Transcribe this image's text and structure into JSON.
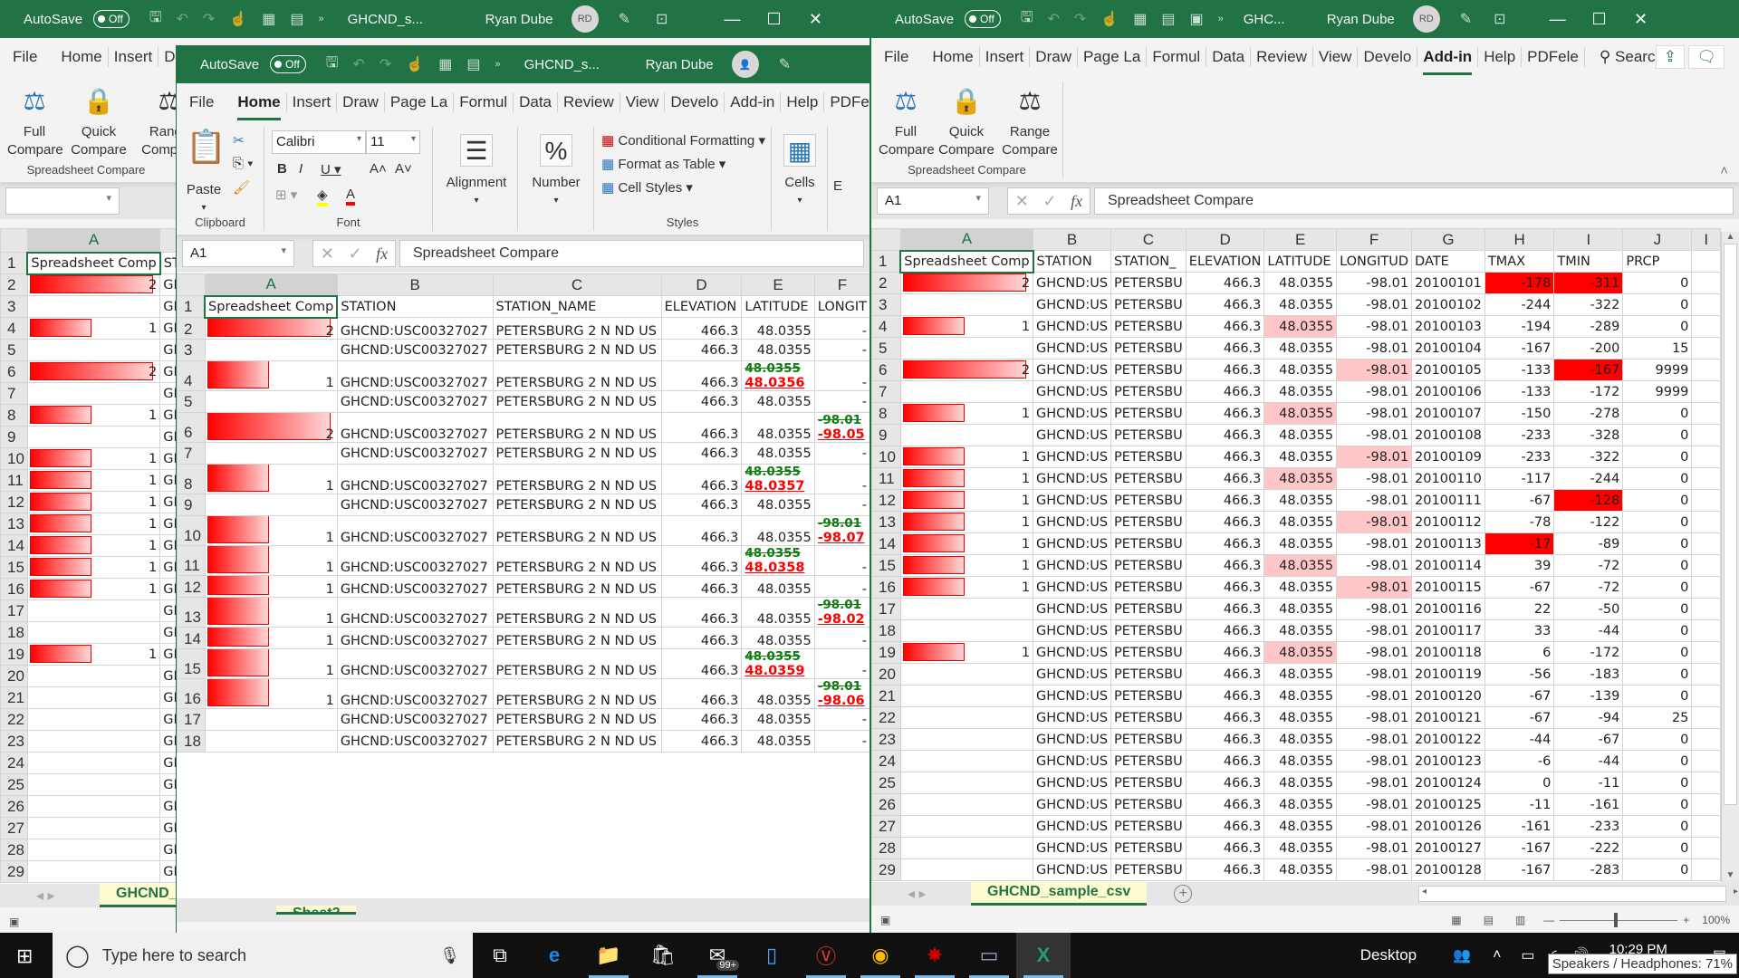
{
  "common": {
    "autosave_label": "AutoSave",
    "autosave_state": "Off",
    "user_name": "Ryan Dube",
    "user_initials": "RD",
    "addin_buttons": [
      {
        "line1": "Full",
        "line2": "Compare"
      },
      {
        "line1": "Quick",
        "line2": "Compare"
      },
      {
        "line1": "Range",
        "line2": "Compare"
      }
    ],
    "addin_group_label": "Spreadsheet Compare"
  },
  "left_window": {
    "title": "GHCND_s...",
    "tabs": [
      "File",
      "Home",
      "Insert",
      "D"
    ],
    "sheet_tab": "GHCND_s",
    "col_header": "A",
    "a1_value": "Spreadsheet Comp",
    "b1_partial": "ST",
    "rows": [
      {
        "r": "1"
      },
      {
        "r": "2",
        "v": "2",
        "w": 1.0
      },
      {
        "r": "3"
      },
      {
        "r": "4",
        "v": "1",
        "w": 0.5
      },
      {
        "r": "5"
      },
      {
        "r": "6",
        "v": "2",
        "w": 1.0
      },
      {
        "r": "7"
      },
      {
        "r": "8",
        "v": "1",
        "w": 0.5
      },
      {
        "r": "9"
      },
      {
        "r": "10",
        "v": "1",
        "w": 0.5
      },
      {
        "r": "11",
        "v": "1",
        "w": 0.5
      },
      {
        "r": "12",
        "v": "1",
        "w": 0.5
      },
      {
        "r": "13",
        "v": "1",
        "w": 0.5
      },
      {
        "r": "14",
        "v": "1",
        "w": 0.5
      },
      {
        "r": "15",
        "v": "1",
        "w": 0.5
      },
      {
        "r": "16",
        "v": "1",
        "w": 0.5
      },
      {
        "r": "17"
      },
      {
        "r": "18"
      },
      {
        "r": "19",
        "v": "1",
        "w": 0.5
      },
      {
        "r": "20"
      },
      {
        "r": "21"
      },
      {
        "r": "22"
      },
      {
        "r": "23"
      },
      {
        "r": "24"
      },
      {
        "r": "25"
      },
      {
        "r": "26"
      },
      {
        "r": "27"
      },
      {
        "r": "28"
      },
      {
        "r": "29"
      }
    ],
    "b_col_partial": "GI"
  },
  "middle_window": {
    "title": "GHCND_s...",
    "tabs": [
      "File",
      "Home",
      "Insert",
      "Draw",
      "Page La",
      "Formul",
      "Data",
      "Review",
      "View",
      "Develo",
      "Add-in",
      "Help",
      "PDFele"
    ],
    "active_tab": "Home",
    "ribbon": {
      "paste_label": "Paste",
      "clipboard_label": "Clipboard",
      "font_name": "Calibri",
      "font_size": "11",
      "font_label": "Font",
      "alignment_label": "Alignment",
      "number_label": "Number",
      "conditional_formatting": "Conditional Formatting",
      "format_as_table": "Format as Table",
      "cell_styles": "Cell Styles",
      "styles_label": "Styles",
      "cells_label": "Cells",
      "editing_partial": "E"
    },
    "name_box": "A1",
    "formula": "Spreadsheet Compare",
    "columns": [
      "A",
      "B",
      "C",
      "D",
      "E",
      "F"
    ],
    "headers": [
      "Spreadsheet Comp",
      "STATION",
      "STATION_NAME",
      "ELEVATION",
      "LATITUDE",
      "LONGIT"
    ],
    "rows": [
      {
        "r": "2",
        "a": "2",
        "w": 1.0,
        "tall": true,
        "e": "48.0355",
        "f": "-"
      },
      {
        "r": "3",
        "e": "48.0355",
        "f": "-"
      },
      {
        "r": "4",
        "a": "1",
        "w": 0.5,
        "tall": true,
        "e_old": "48.0355",
        "e_new": "48.0356",
        "f": "-"
      },
      {
        "r": "5",
        "e": "48.0355",
        "f": "-"
      },
      {
        "r": "6",
        "a": "2",
        "w": 1.0,
        "tall": true,
        "e": "48.0355",
        "f_old": "-98.01",
        "f_new": "-98.05"
      },
      {
        "r": "7",
        "e": "48.0355",
        "f": "-"
      },
      {
        "r": "8",
        "a": "1",
        "w": 0.5,
        "tall": true,
        "e_old": "48.0355",
        "e_new": "48.0357",
        "f": "-"
      },
      {
        "r": "9",
        "e": "48.0355",
        "f": "-"
      },
      {
        "r": "10",
        "a": "1",
        "w": 0.5,
        "tall": true,
        "e": "48.0355",
        "f_old": "-98.01",
        "f_new": "-98.07"
      },
      {
        "r": "11",
        "a": "1",
        "w": 0.5,
        "tall": true,
        "e_old": "48.0355",
        "e_new": "48.0358",
        "f": "-"
      },
      {
        "r": "12",
        "a": "1",
        "w": 0.5,
        "tall": true,
        "e": "48.0355",
        "f": "-"
      },
      {
        "r": "13",
        "a": "1",
        "w": 0.5,
        "tall": true,
        "e": "48.0355",
        "f_old": "-98.01",
        "f_new": "-98.02"
      },
      {
        "r": "14",
        "a": "1",
        "w": 0.5,
        "tall": true,
        "e": "48.0355",
        "f": "-"
      },
      {
        "r": "15",
        "a": "1",
        "w": 0.5,
        "tall": true,
        "e_old": "48.0355",
        "e_new": "48.0359",
        "f": "-"
      },
      {
        "r": "16",
        "a": "1",
        "w": 0.5,
        "tall": true,
        "e": "48.0355",
        "f_old": "-98.01",
        "f_new": "-98.06"
      },
      {
        "r": "17",
        "e": "48.0355",
        "f": "-"
      },
      {
        "r": "18",
        "e": "48.0355",
        "f": "-"
      }
    ],
    "station": "GHCND:USC00327027",
    "station_name": "PETERSBURG 2 N ND US",
    "elevation": "466.3",
    "sheet_tab_partial": "Sheet2"
  },
  "right_window": {
    "title": "GHC...",
    "tabs": [
      "File",
      "Home",
      "Insert",
      "Draw",
      "Page La",
      "Formul",
      "Data",
      "Review",
      "View",
      "Develo",
      "Add-in",
      "Help",
      "PDFele"
    ],
    "active_tab": "Add-in",
    "search_label": "Search",
    "name_box": "A1",
    "formula": "Spreadsheet Compare",
    "columns": [
      "A",
      "B",
      "C",
      "D",
      "E",
      "F",
      "G",
      "H",
      "I",
      "J"
    ],
    "headers": [
      "Spreadsheet Comp",
      "STATION",
      "STATION_",
      "ELEVATION",
      "LATITUDE",
      "LONGITUD",
      "DATE",
      "TMAX",
      "TMIN",
      "PRCP"
    ],
    "station_partial": "GHCND:US",
    "name_partial": "PETERSBU",
    "elevation": "466.3",
    "latitude": "48.0355",
    "longitude": "-98.01",
    "rows": [
      {
        "r": "2",
        "a": "2",
        "w": 1.0,
        "date": "20100101",
        "tmax": "-178",
        "tmin": "-311",
        "prcp": "0",
        "hl": [
          "H",
          "I"
        ]
      },
      {
        "r": "3",
        "date": "20100102",
        "tmax": "-244",
        "tmin": "-322",
        "prcp": "0"
      },
      {
        "r": "4",
        "a": "1",
        "w": 0.5,
        "date": "20100103",
        "tmax": "-194",
        "tmin": "-289",
        "prcp": "0",
        "pink": [
          "E"
        ]
      },
      {
        "r": "5",
        "date": "20100104",
        "tmax": "-167",
        "tmin": "-200",
        "prcp": "15"
      },
      {
        "r": "6",
        "a": "2",
        "w": 1.0,
        "date": "20100105",
        "tmax": "-133",
        "tmin": "-167",
        "prcp": "9999",
        "pink": [
          "F"
        ],
        "hl": [
          "I"
        ]
      },
      {
        "r": "7",
        "date": "20100106",
        "tmax": "-133",
        "tmin": "-172",
        "prcp": "9999"
      },
      {
        "r": "8",
        "a": "1",
        "w": 0.5,
        "date": "20100107",
        "tmax": "-150",
        "tmin": "-278",
        "prcp": "0",
        "pink": [
          "E"
        ]
      },
      {
        "r": "9",
        "date": "20100108",
        "tmax": "-233",
        "tmin": "-328",
        "prcp": "0"
      },
      {
        "r": "10",
        "a": "1",
        "w": 0.5,
        "date": "20100109",
        "tmax": "-233",
        "tmin": "-322",
        "prcp": "0",
        "pink": [
          "F"
        ]
      },
      {
        "r": "11",
        "a": "1",
        "w": 0.5,
        "date": "20100110",
        "tmax": "-117",
        "tmin": "-244",
        "prcp": "0",
        "pink": [
          "E"
        ]
      },
      {
        "r": "12",
        "a": "1",
        "w": 0.5,
        "date": "20100111",
        "tmax": "-67",
        "tmin": "-128",
        "prcp": "0",
        "hl": [
          "I"
        ]
      },
      {
        "r": "13",
        "a": "1",
        "w": 0.5,
        "date": "20100112",
        "tmax": "-78",
        "tmin": "-122",
        "prcp": "0",
        "pink": [
          "F"
        ]
      },
      {
        "r": "14",
        "a": "1",
        "w": 0.5,
        "date": "20100113",
        "tmax": "-17",
        "tmin": "-89",
        "prcp": "0",
        "hl": [
          "H"
        ]
      },
      {
        "r": "15",
        "a": "1",
        "w": 0.5,
        "date": "20100114",
        "tmax": "39",
        "tmin": "-72",
        "prcp": "0",
        "pink": [
          "E"
        ]
      },
      {
        "r": "16",
        "a": "1",
        "w": 0.5,
        "date": "20100115",
        "tmax": "-67",
        "tmin": "-72",
        "prcp": "0",
        "pink": [
          "F"
        ]
      },
      {
        "r": "17",
        "date": "20100116",
        "tmax": "22",
        "tmin": "-50",
        "prcp": "0"
      },
      {
        "r": "18",
        "date": "20100117",
        "tmax": "33",
        "tmin": "-44",
        "prcp": "0"
      },
      {
        "r": "19",
        "a": "1",
        "w": 0.5,
        "date": "20100118",
        "tmax": "6",
        "tmin": "-172",
        "prcp": "0",
        "pink": [
          "E"
        ]
      },
      {
        "r": "20",
        "date": "20100119",
        "tmax": "-56",
        "tmin": "-183",
        "prcp": "0"
      },
      {
        "r": "21",
        "date": "20100120",
        "tmax": "-67",
        "tmin": "-139",
        "prcp": "0"
      },
      {
        "r": "22",
        "date": "20100121",
        "tmax": "-67",
        "tmin": "-94",
        "prcp": "25"
      },
      {
        "r": "23",
        "date": "20100122",
        "tmax": "-44",
        "tmin": "-67",
        "prcp": "0"
      },
      {
        "r": "24",
        "date": "20100123",
        "tmax": "-6",
        "tmin": "-44",
        "prcp": "0"
      },
      {
        "r": "25",
        "date": "20100124",
        "tmax": "0",
        "tmin": "-11",
        "prcp": "0"
      },
      {
        "r": "26",
        "date": "20100125",
        "tmax": "-11",
        "tmin": "-161",
        "prcp": "0"
      },
      {
        "r": "27",
        "date": "20100126",
        "tmax": "-161",
        "tmin": "-233",
        "prcp": "0"
      },
      {
        "r": "28",
        "date": "20100127",
        "tmax": "-167",
        "tmin": "-222",
        "prcp": "0"
      },
      {
        "r": "29",
        "date": "20100128",
        "tmax": "-167",
        "tmin": "-283",
        "prcp": "0"
      }
    ],
    "sheet_tab": "GHCND_sample_csv",
    "zoom_level": "100%"
  },
  "taskbar": {
    "search_placeholder": "Type here to search",
    "mail_badge": "99+",
    "desktop_label": "Desktop",
    "time": "10:29 PM",
    "tooltip": "Speakers / Headphones: 71%"
  },
  "colors": {
    "excel_green": "#217346",
    "diff_red": "#ff0000",
    "diff_pink": "#ffc7c7",
    "old_value_green": "#107c10"
  }
}
